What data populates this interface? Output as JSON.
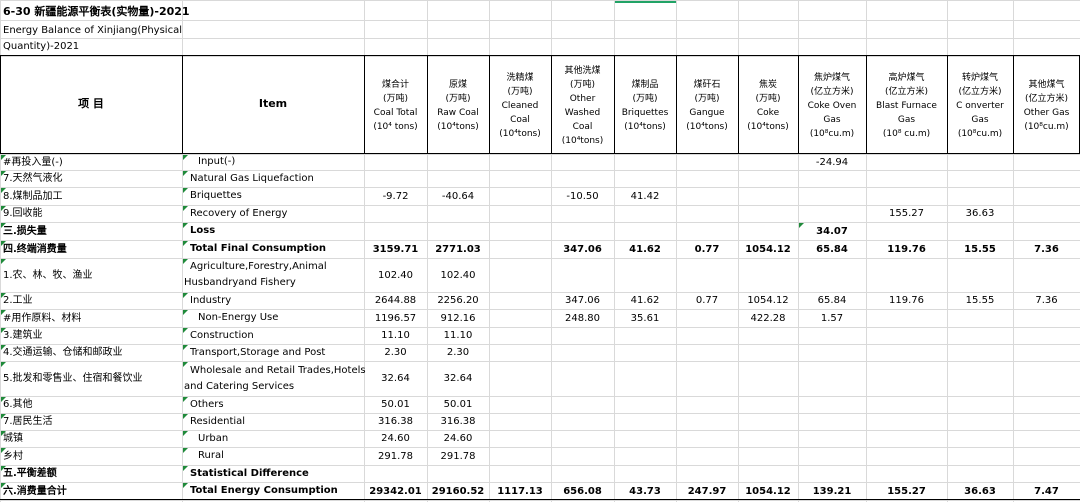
{
  "title": {
    "cn": "6-30 新疆能源平衡表(实物量)-2021",
    "en_line1": "Energy Balance of Xinjiang(Physical",
    "en_line2": "Quantity)-2021"
  },
  "header": {
    "item_cn": "项  目",
    "item_en": "Item",
    "columns": [
      {
        "lines": [
          "煤合计",
          "(万吨)",
          "Coal Total",
          "(10⁴ tons)"
        ]
      },
      {
        "lines": [
          "原煤",
          "(万吨)",
          "Raw Coal",
          "(10⁴tons)"
        ]
      },
      {
        "lines": [
          "洗精煤",
          "(万吨)",
          "Cleaned",
          "Coal",
          "(10⁴tons)"
        ]
      },
      {
        "lines": [
          "其他洗煤",
          "(万吨)",
          "Other",
          "Washed",
          "Coal",
          "(10⁴tons)"
        ]
      },
      {
        "lines": [
          "煤制品",
          "(万吨)",
          "Briquettes",
          "(10⁴tons)"
        ]
      },
      {
        "lines": [
          "煤矸石",
          "(万吨)",
          "Gangue",
          "(10⁴tons)"
        ]
      },
      {
        "lines": [
          "焦炭",
          "(万吨)",
          "Coke",
          "(10⁴tons)"
        ]
      },
      {
        "lines": [
          "焦炉煤气",
          "(亿立方米)",
          "Coke Oven",
          "Gas",
          "(10⁸cu.m)"
        ]
      },
      {
        "lines": [
          "高炉煤气",
          "(亿立方米)",
          "Blast Furnace",
          "Gas",
          "(10⁸ cu.m)"
        ]
      },
      {
        "lines": [
          "转炉煤气",
          "(亿立方米)",
          "C onverter",
          "Gas",
          "(10⁸cu.m)"
        ]
      },
      {
        "lines": [
          "其他煤气",
          "(亿立方米)",
          "Other Gas",
          "(10⁸cu.m)"
        ]
      }
    ]
  },
  "rows": [
    {
      "cn": "  #再投入量(-)",
      "en": [
        "Input(-)"
      ],
      "en_indent": 1,
      "bold": false,
      "values": [
        "",
        "",
        "",
        "",
        "",
        "",
        "",
        "-24.94",
        "",
        "",
        ""
      ]
    },
    {
      "cn": "7.天然气液化",
      "en": [
        "Natural Gas Liquefaction"
      ],
      "en_indent": 0,
      "bold": false,
      "values": [
        "",
        "",
        "",
        "",
        "",
        "",
        "",
        "",
        "",
        "",
        ""
      ]
    },
    {
      "cn": "8.煤制品加工",
      "en": [
        "Briquettes"
      ],
      "en_indent": 0,
      "bold": false,
      "values": [
        "-9.72",
        "-40.64",
        "",
        "-10.50",
        "41.42",
        "",
        "",
        "",
        "",
        "",
        ""
      ]
    },
    {
      "cn": "9.回收能",
      "en": [
        "Recovery of Energy"
      ],
      "en_indent": 0,
      "bold": false,
      "values": [
        "",
        "",
        "",
        "",
        "",
        "",
        "",
        "",
        "155.27",
        "36.63",
        ""
      ]
    },
    {
      "cn": "三.损失量",
      "en": [
        "Loss"
      ],
      "en_indent": 0,
      "bold": true,
      "values": [
        "",
        "",
        "",
        "",
        "",
        "",
        "",
        "34.07",
        "",
        "",
        ""
      ]
    },
    {
      "cn": "四.终端消费量",
      "en": [
        "Total Final Consumption"
      ],
      "en_indent": 0,
      "bold": true,
      "values": [
        "3159.71",
        "2771.03",
        "",
        "347.06",
        "41.62",
        "0.77",
        "1054.12",
        "65.84",
        "119.76",
        "15.55",
        "7.36"
      ]
    },
    {
      "cn": " 1.农、林、牧、渔业",
      "en": [
        "Agriculture,Forestry,Animal",
        "Husbandryand Fishery"
      ],
      "en_indent": 0,
      "bold": false,
      "values": [
        "102.40",
        "102.40",
        "",
        "",
        "",
        "",
        "",
        "",
        "",
        "",
        ""
      ]
    },
    {
      "cn": " 2.工业",
      "en": [
        "Industry"
      ],
      "en_indent": 0,
      "bold": false,
      "values": [
        "2644.88",
        "2256.20",
        "",
        "347.06",
        "41.62",
        "0.77",
        "1054.12",
        "65.84",
        "119.76",
        "15.55",
        "7.36"
      ]
    },
    {
      "cn": "   #用作原料、材料",
      "en": [
        "Non-Energy Use"
      ],
      "en_indent": 1,
      "bold": false,
      "values": [
        "1196.57",
        "912.16",
        "",
        "248.80",
        "35.61",
        "",
        "422.28",
        "1.57",
        "",
        "",
        ""
      ]
    },
    {
      "cn": " 3.建筑业",
      "en": [
        "Construction"
      ],
      "en_indent": 0,
      "bold": false,
      "values": [
        "11.10",
        "11.10",
        "",
        "",
        "",
        "",
        "",
        "",
        "",
        "",
        ""
      ]
    },
    {
      "cn": " 4.交通运输、仓储和邮政业",
      "en": [
        "Transport,Storage and Post"
      ],
      "en_indent": 0,
      "bold": false,
      "values": [
        "2.30",
        "2.30",
        "",
        "",
        "",
        "",
        "",
        "",
        "",
        "",
        ""
      ]
    },
    {
      "cn": " 5.批发和零售业、住宿和餐饮业",
      "en": [
        "Wholesale and Retail Trades,Hotels",
        "and Catering Services"
      ],
      "en_indent": 0,
      "bold": false,
      "values": [
        "32.64",
        "32.64",
        "",
        "",
        "",
        "",
        "",
        "",
        "",
        "",
        ""
      ]
    },
    {
      "cn": " 6.其他",
      "en": [
        "Others"
      ],
      "en_indent": 0,
      "bold": false,
      "values": [
        "50.01",
        "50.01",
        "",
        "",
        "",
        "",
        "",
        "",
        "",
        "",
        ""
      ]
    },
    {
      "cn": " 7.居民生活",
      "en": [
        "Residential"
      ],
      "en_indent": 0,
      "bold": false,
      "values": [
        "316.38",
        "316.38",
        "",
        "",
        "",
        "",
        "",
        "",
        "",
        "",
        ""
      ]
    },
    {
      "cn": "   城镇",
      "en": [
        "Urban"
      ],
      "en_indent": 1,
      "bold": false,
      "values": [
        "24.60",
        "24.60",
        "",
        "",
        "",
        "",
        "",
        "",
        "",
        "",
        ""
      ]
    },
    {
      "cn": "   乡村",
      "en": [
        "Rural"
      ],
      "en_indent": 1,
      "bold": false,
      "values": [
        "291.78",
        "291.78",
        "",
        "",
        "",
        "",
        "",
        "",
        "",
        "",
        ""
      ]
    },
    {
      "cn": "五.平衡差额",
      "en": [
        "Statistical Difference"
      ],
      "en_indent": 0,
      "bold": true,
      "values": [
        "",
        "",
        "",
        "",
        "",
        "",
        "",
        "",
        "",
        "",
        ""
      ]
    },
    {
      "cn": "六.消费量合计",
      "en": [
        "Total Energy Consumption"
      ],
      "en_indent": 0,
      "bold": true,
      "values": [
        "29342.01",
        "29160.52",
        "1117.13",
        "656.08",
        "43.73",
        "247.97",
        "1054.12",
        "139.21",
        "155.27",
        "36.63",
        "7.47"
      ]
    }
  ]
}
